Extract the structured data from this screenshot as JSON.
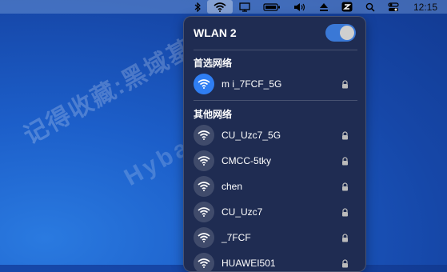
{
  "menubar": {
    "items": [
      {
        "icon": "bluetooth-icon"
      },
      {
        "icon": "wifi-icon"
      },
      {
        "icon": "display-icon"
      },
      {
        "icon": "battery-icon"
      },
      {
        "icon": "volume-icon"
      },
      {
        "icon": "eject-icon"
      },
      {
        "icon": "app-icon"
      },
      {
        "icon": "search-icon"
      },
      {
        "icon": "control-center-icon"
      }
    ],
    "clock": "12:15"
  },
  "wifi_panel": {
    "title": "WLAN 2",
    "enabled": true,
    "preferred_label": "首选网络",
    "preferred_network": {
      "name": "m i_7FCF_5G",
      "connected": true,
      "secured": true
    },
    "other_label": "其他网络",
    "other_networks": [
      {
        "name": "CU_Uzc7_5G",
        "secured": true
      },
      {
        "name": "CMCC-5tky",
        "secured": true
      },
      {
        "name": "chen",
        "secured": true
      },
      {
        "name": "CU_Uzc7",
        "secured": true
      },
      {
        "name": "_7FCF",
        "secured": true
      },
      {
        "name": "HUAWEI501",
        "secured": true
      }
    ]
  },
  "watermark": {
    "line1": "记得收藏:黑域基地",
    "line2": "Hybase.com"
  },
  "colors": {
    "accent": "#3a78d6",
    "panel_bg": "#1f2c52",
    "desktop": "#1c5ec9"
  }
}
